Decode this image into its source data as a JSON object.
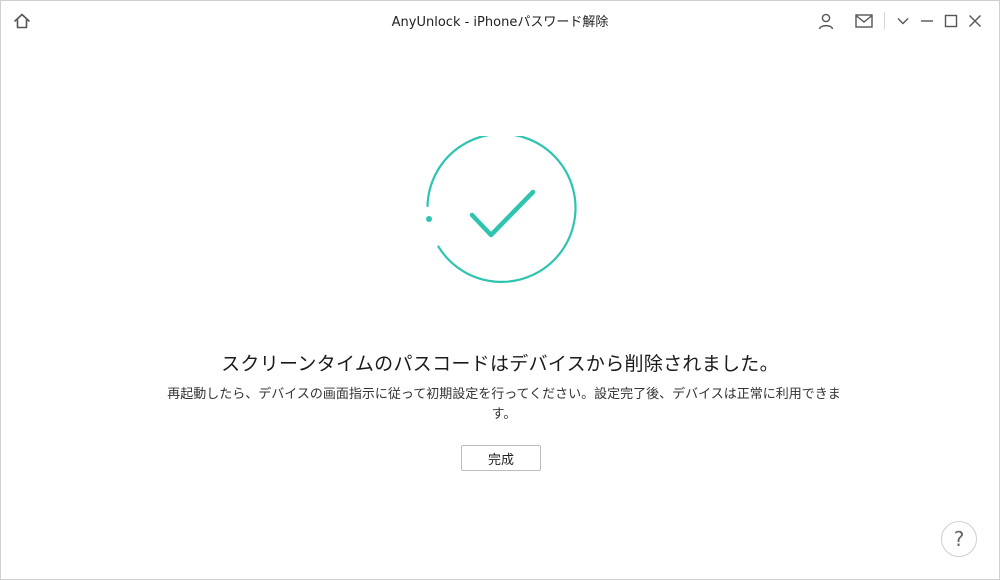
{
  "window": {
    "title": "AnyUnlock - iPhoneパスワード解除"
  },
  "titlebar": {
    "home_icon": "home-icon",
    "account_icon": "user-icon",
    "mail_icon": "mail-icon",
    "menu_icon": "chevron-down-icon",
    "minimize_icon": "minimize-icon",
    "maximize_icon": "maximize-icon",
    "close_icon": "close-icon"
  },
  "main": {
    "status_icon": "check-circle-icon",
    "accent_color": "#2ec4b0",
    "headline": "スクリーンタイムのパスコードはデバイスから削除されました。",
    "description": "再起動したら、デバイスの画面指示に従って初期設定を行ってください。設定完了後、デバイスは正常に利用できます。",
    "done_label": "完成"
  },
  "help": {
    "label": "?"
  }
}
